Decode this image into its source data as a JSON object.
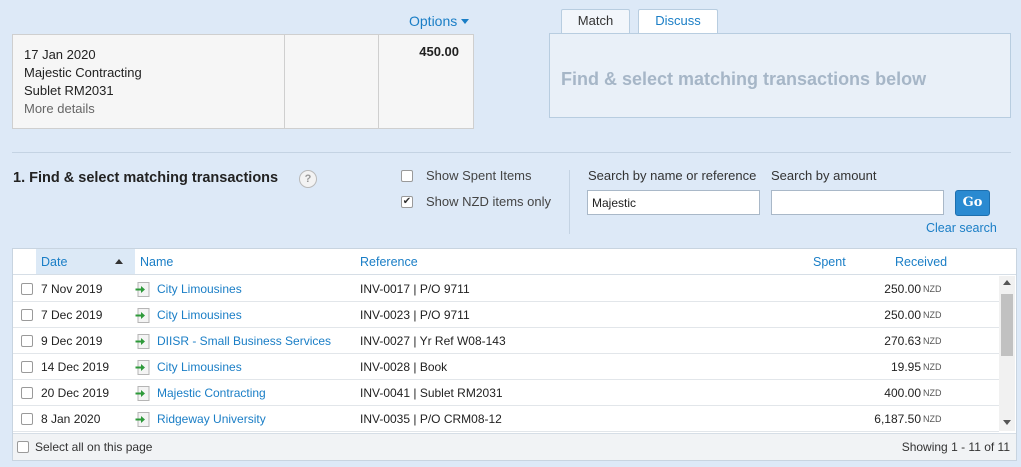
{
  "statement": {
    "options_label": "Options",
    "date": "17 Jan 2020",
    "payee": "Majestic Contracting",
    "description": "Sublet RM2031",
    "more_details": "More details",
    "amount": "450.00"
  },
  "tabs": {
    "match": "Match",
    "discuss": "Discuss"
  },
  "match_panel": {
    "message": "Find & select matching transactions below"
  },
  "find": {
    "title": "1. Find & select matching transactions",
    "help": "?",
    "show_spent_label": "Show Spent Items",
    "show_spent_checked": false,
    "show_nzd_label": "Show NZD items only",
    "show_nzd_checked": true,
    "search_name_label": "Search by name or reference",
    "search_name_value": "Majestic",
    "search_amount_label": "Search by amount",
    "search_amount_value": "",
    "go_label": "Go",
    "clear_search": "Clear search"
  },
  "table": {
    "columns": {
      "date": "Date",
      "name": "Name",
      "reference": "Reference",
      "spent": "Spent",
      "received": "Received"
    },
    "rows": [
      {
        "date": "7 Nov 2019",
        "name": "City Limousines",
        "reference": "INV-0017 | P/O 9711",
        "received": "250.00",
        "currency": "NZD"
      },
      {
        "date": "7 Dec 2019",
        "name": "City Limousines",
        "reference": "INV-0023 | P/O 9711",
        "received": "250.00",
        "currency": "NZD"
      },
      {
        "date": "9 Dec 2019",
        "name": "DIISR - Small Business Services",
        "reference": "INV-0027 | Yr Ref W08-143",
        "received": "270.63",
        "currency": "NZD"
      },
      {
        "date": "14 Dec 2019",
        "name": "City Limousines",
        "reference": "INV-0028 | Book",
        "received": "19.95",
        "currency": "NZD"
      },
      {
        "date": "20 Dec 2019",
        "name": "Majestic Contracting",
        "reference": "INV-0041 | Sublet RM2031",
        "received": "400.00",
        "currency": "NZD"
      },
      {
        "date": "8 Jan 2020",
        "name": "Ridgeway University",
        "reference": "INV-0035 | P/O CRM08-12",
        "received": "6,187.50",
        "currency": "NZD"
      }
    ],
    "select_all": "Select all on this page",
    "showing": "Showing 1 - 11 of 11"
  },
  "colors": {
    "accent": "#1a7ec6",
    "background": "#dde9f7",
    "go_button": "#2a8ad1"
  }
}
